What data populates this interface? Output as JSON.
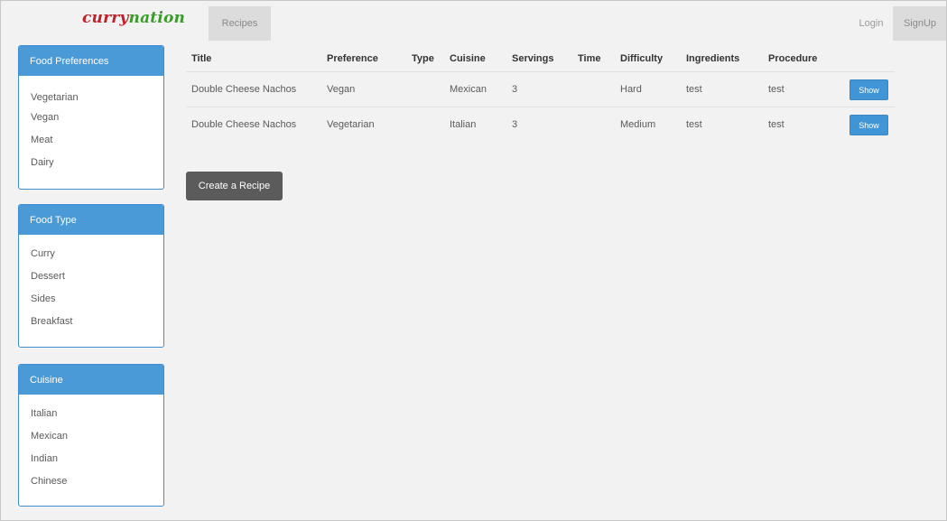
{
  "nav": {
    "brand_part1": "curry",
    "brand_part2": "nation",
    "recipes_link": "Recipes",
    "login_link": "Login",
    "signup_link": "SignUp"
  },
  "sidebar": {
    "food_preferences": {
      "title": "Food Preferences",
      "items": [
        "Vegetarian",
        "Vegan",
        "Meat",
        "Dairy"
      ]
    },
    "food_type": {
      "title": "Food Type",
      "items": [
        "Curry",
        "Dessert",
        "Sides",
        "Breakfast"
      ]
    },
    "cuisine": {
      "title": "Cuisine",
      "items": [
        "Italian",
        "Mexican",
        "Indian",
        "Chinese"
      ]
    }
  },
  "table": {
    "headers": [
      "Title",
      "Preference",
      "Type",
      "Cuisine",
      "Servings",
      "Time",
      "Difficulty",
      "Ingredients",
      "Procedure"
    ],
    "rows": [
      {
        "title": "Double Cheese Nachos",
        "preference": "Vegan",
        "type": "",
        "cuisine": "Mexican",
        "servings": "3",
        "time": "",
        "difficulty": "Hard",
        "ingredients": "test",
        "procedure": "test",
        "action": "Show"
      },
      {
        "title": "Double Cheese Nachos",
        "preference": "Vegetarian",
        "type": "",
        "cuisine": "Italian",
        "servings": "3",
        "time": "",
        "difficulty": "Medium",
        "ingredients": "test",
        "procedure": "test",
        "action": "Show"
      }
    ]
  },
  "create_button": "Create a Recipe",
  "colors": {
    "panel_header": "#4a9ad8",
    "show_button": "#3f95d5",
    "create_button": "#5b5b5b",
    "brand_red": "#c0202a",
    "brand_green": "#3b9a2a"
  }
}
